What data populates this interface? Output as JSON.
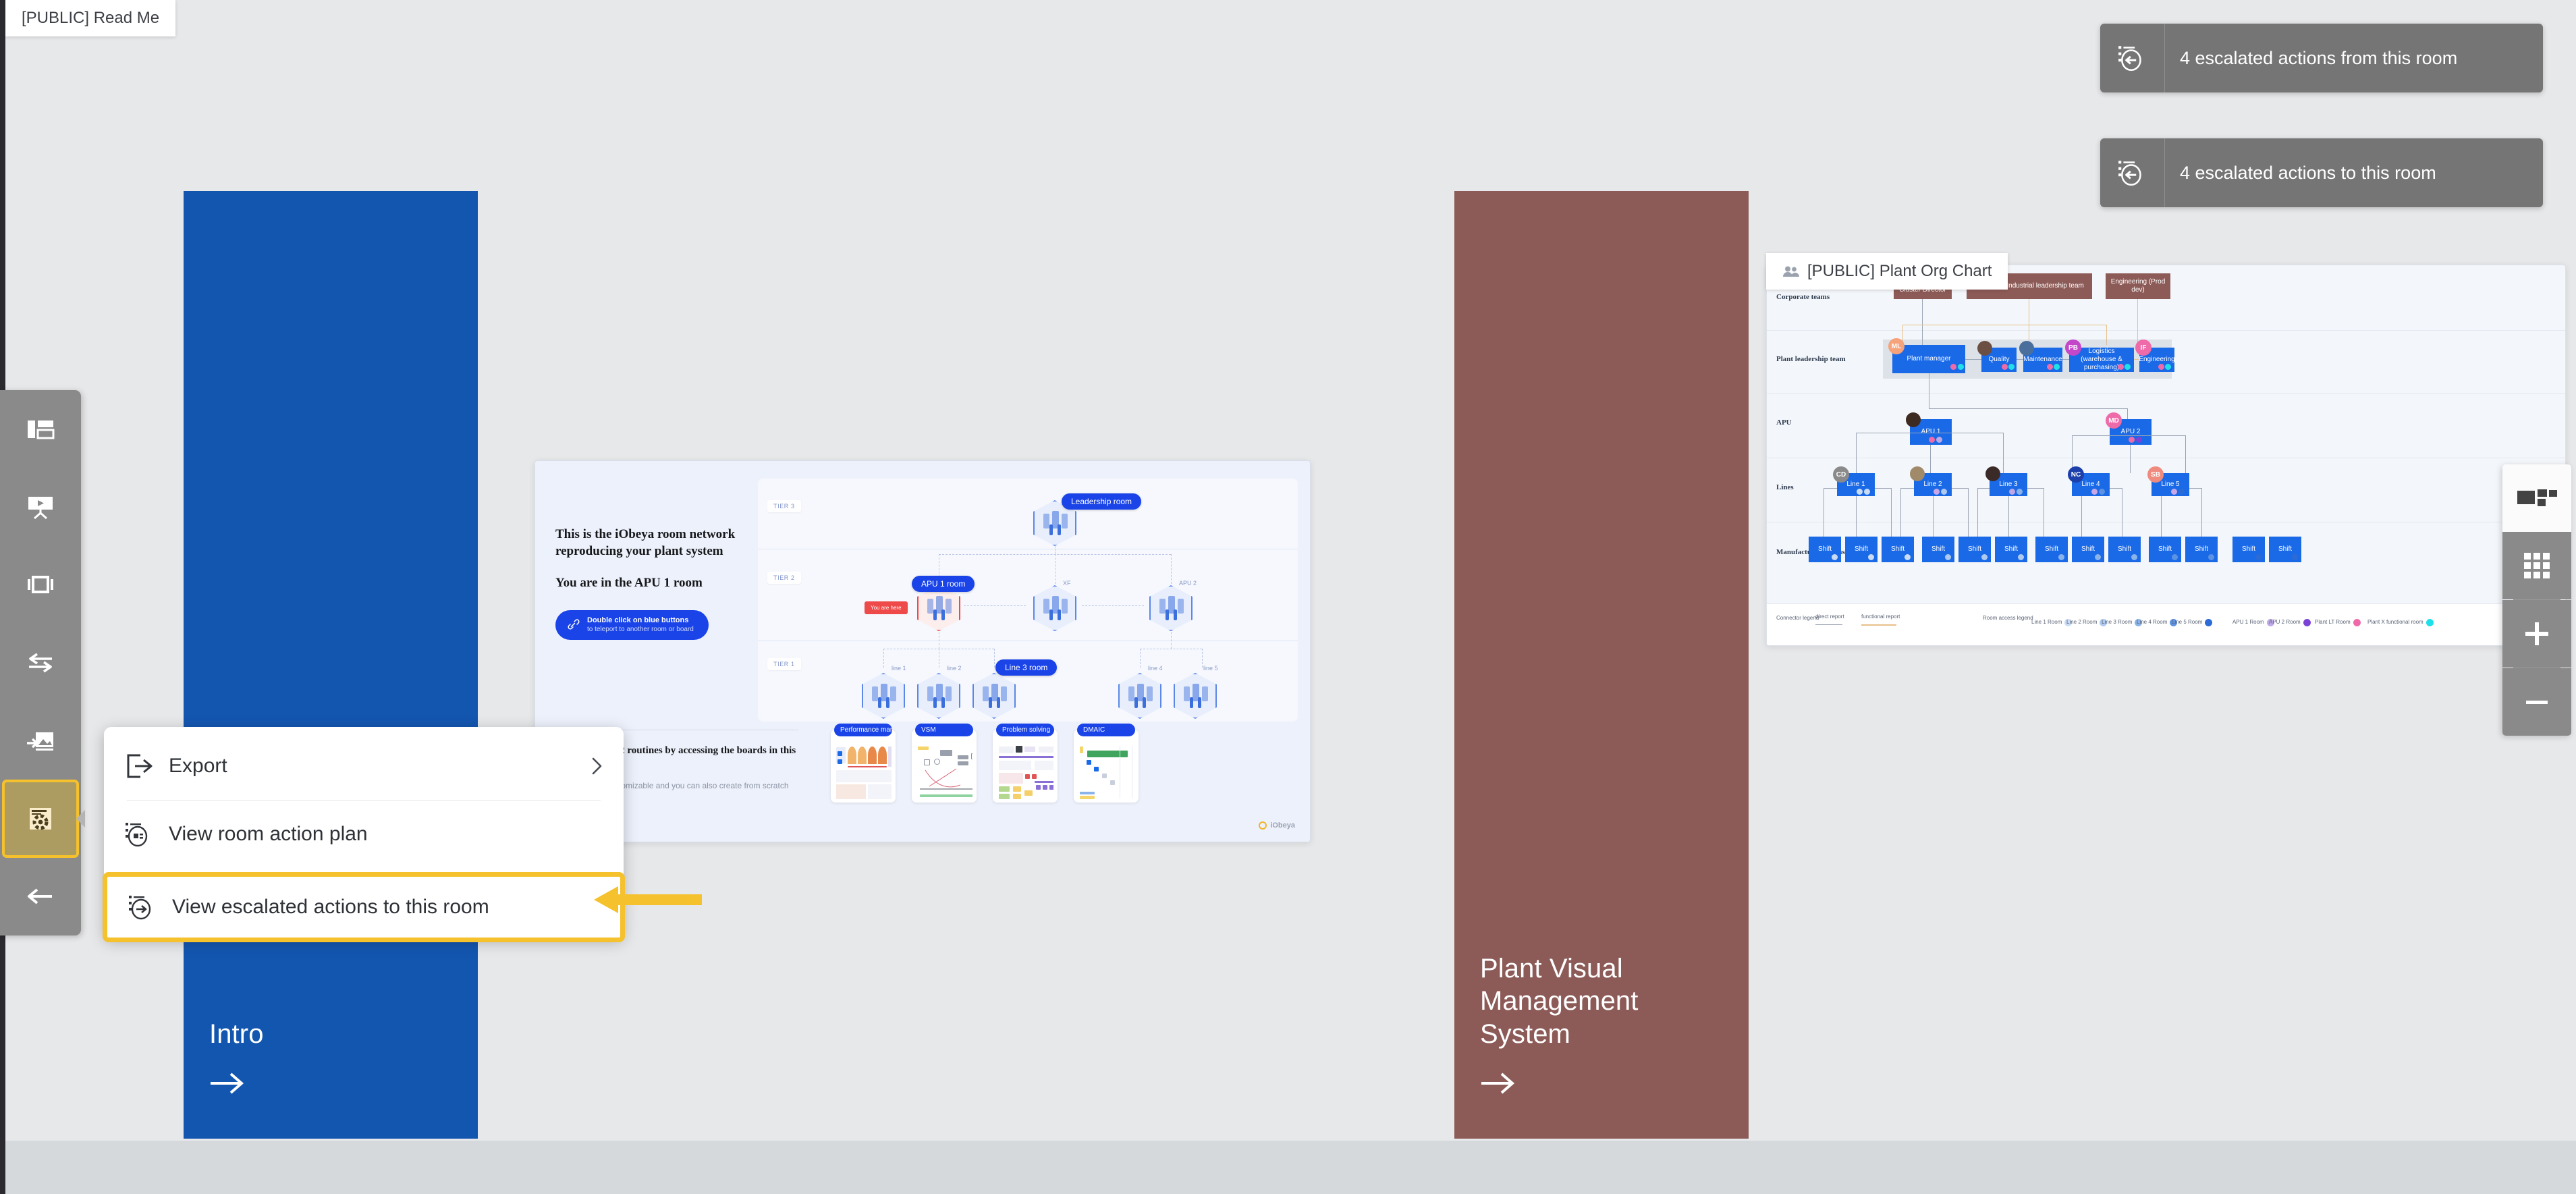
{
  "app": {
    "canvas_background": "#e7e8ea",
    "accent_highlight": "#f5c12c",
    "toolbar_background": "#8a8a8a"
  },
  "room_cards": [
    {
      "title": "Intro",
      "color": "#1356b0",
      "arrow_icon": "arrow-right-icon"
    },
    {
      "title": "Plant Visual Management System",
      "color": "#8d5b57",
      "arrow_icon": "arrow-right-icon"
    }
  ],
  "boards": {
    "readme": {
      "tab_label": "[PUBLIC] Read Me",
      "tab_icon": "board-icon",
      "heading_1": "This is the iObeya room network reproducing your plant system",
      "heading_2": "You are in the APU 1 room",
      "pill_line_1": "Double click on blue buttons",
      "pill_line_2": "to teleport to another room or board",
      "pill_icon": "link-icon",
      "lower_heading": "Run your Tier 2 routines by accessing the boards in this room",
      "lower_text": "They are fully customizable and you can also create from scratch",
      "logo_text": "iObeya",
      "network": {
        "tiers": [
          "TIER 3",
          "TIER 2",
          "TIER 1"
        ],
        "you_are_here_label": "You are here",
        "nodes": [
          {
            "label": "Leadership room",
            "style": "pill",
            "tier": "TIER 3"
          },
          {
            "label": "APU 1 room",
            "style": "pill",
            "tier": "TIER 2",
            "selected": true
          },
          {
            "label": "XF",
            "style": "plain",
            "tier": "TIER 2"
          },
          {
            "label": "APU 2",
            "style": "plain",
            "tier": "TIER 2"
          },
          {
            "label": "line 1",
            "style": "plain",
            "tier": "TIER 1"
          },
          {
            "label": "line 2",
            "style": "plain",
            "tier": "TIER 1"
          },
          {
            "label": "Line 3 room",
            "style": "pill",
            "tier": "TIER 1"
          },
          {
            "label": "line 4",
            "style": "plain",
            "tier": "TIER 1"
          },
          {
            "label": "line 5",
            "style": "plain",
            "tier": "TIER 1"
          }
        ]
      },
      "thumbnails": [
        {
          "label": "Performance management"
        },
        {
          "label": "VSM"
        },
        {
          "label": "Problem solving"
        },
        {
          "label": "DMAIC"
        }
      ]
    },
    "orgchart": {
      "tab_label": "[PUBLIC] Plant Org Chart",
      "tab_icon": "people-icon",
      "row_labels": [
        "Corporate teams",
        "Plant leadership team",
        "APU",
        "Lines",
        "Manufacturing teams"
      ],
      "corporate_boxes": [
        "Business Unit / Cluster Director",
        "Corporate Industrial leadership team",
        "Engineering (Prod dev)"
      ],
      "leadership_boxes": [
        "Plant manager",
        "Quality",
        "Maintenance",
        "Logistics (warehouse & purchasing)",
        "Engineering"
      ],
      "apu_boxes": [
        "APU 1",
        "APU 2"
      ],
      "line_boxes": [
        "Line 1",
        "Line 2",
        "Line 3",
        "Line 4",
        "Line 5"
      ],
      "shift_label": "Shift",
      "shifts_per_line": [
        3,
        3,
        3,
        2,
        2
      ],
      "avatars": [
        {
          "initials": "ML",
          "color": "#f6a27a"
        },
        {
          "initials": "CD",
          "color": "#8a8a8a"
        },
        {
          "initials": "PB",
          "color": "#c447c9"
        },
        {
          "initials": "IF",
          "color": "#ef6aa8"
        },
        {
          "initials": "MD",
          "color": "#ef6aa8"
        },
        {
          "initials": "NC",
          "color": "#1c3faa"
        },
        {
          "initials": "SB",
          "color": "#ef8a7e"
        }
      ],
      "legend": {
        "connector_legend_label": "Connector legend",
        "connector_items": [
          {
            "label": "direct report",
            "color": "#9aa4b4"
          },
          {
            "label": "functional report",
            "color": "#e8c08a"
          }
        ],
        "room_access_label": "Room access legend",
        "room_items": [
          {
            "label": "Line 1 Room",
            "color": "#c9dbf5"
          },
          {
            "label": "Line 2 Room",
            "color": "#aecaf0"
          },
          {
            "label": "Line 3 Room",
            "color": "#8ab3ea"
          },
          {
            "label": "Line 4 Room",
            "color": "#5c92e2"
          },
          {
            "label": "Line 5 Room",
            "color": "#2a6bd6"
          },
          {
            "label": "APU 1 Room",
            "color": "#bda8e8"
          },
          {
            "label": "APU 2 Room",
            "color": "#7a43d6"
          },
          {
            "label": "Plant LT Room",
            "color": "#ef6aa8"
          },
          {
            "label": "Plant X functional room",
            "color": "#1fe0e8"
          }
        ]
      }
    }
  },
  "left_toolbar": {
    "items": [
      {
        "icon": "board-layout-icon",
        "active": false
      },
      {
        "icon": "presentation-icon",
        "active": false
      },
      {
        "icon": "slideshow-icon",
        "active": false
      },
      {
        "icon": "transfer-arrows-icon",
        "active": false
      },
      {
        "icon": "image-export-icon",
        "active": false
      },
      {
        "icon": "room-options-icon",
        "active": true
      },
      {
        "icon": "back-arrow-icon",
        "active": false
      }
    ]
  },
  "context_menu": {
    "items": [
      {
        "label": "Export",
        "icon": "export-icon",
        "has_submenu": true,
        "highlighted": false
      },
      {
        "label": "View room action plan",
        "icon": "action-plan-icon",
        "has_submenu": false,
        "highlighted": false
      },
      {
        "label": "View escalated actions to this room",
        "icon": "escalated-in-icon",
        "has_submenu": false,
        "highlighted": true
      }
    ]
  },
  "tooltips": [
    {
      "text": "4 escalated actions from this room",
      "icon": "escalated-out-icon"
    },
    {
      "text": "4 escalated actions to this room",
      "icon": "escalated-in-icon"
    }
  ],
  "right_toolbar": {
    "buttons": [
      {
        "icon": "layout-tiles-icon",
        "style": "light"
      },
      {
        "icon": "grid-icon",
        "style": "dark"
      },
      {
        "icon": "zoom-in-icon",
        "style": "dark"
      },
      {
        "icon": "zoom-out-icon",
        "style": "dark"
      }
    ]
  }
}
